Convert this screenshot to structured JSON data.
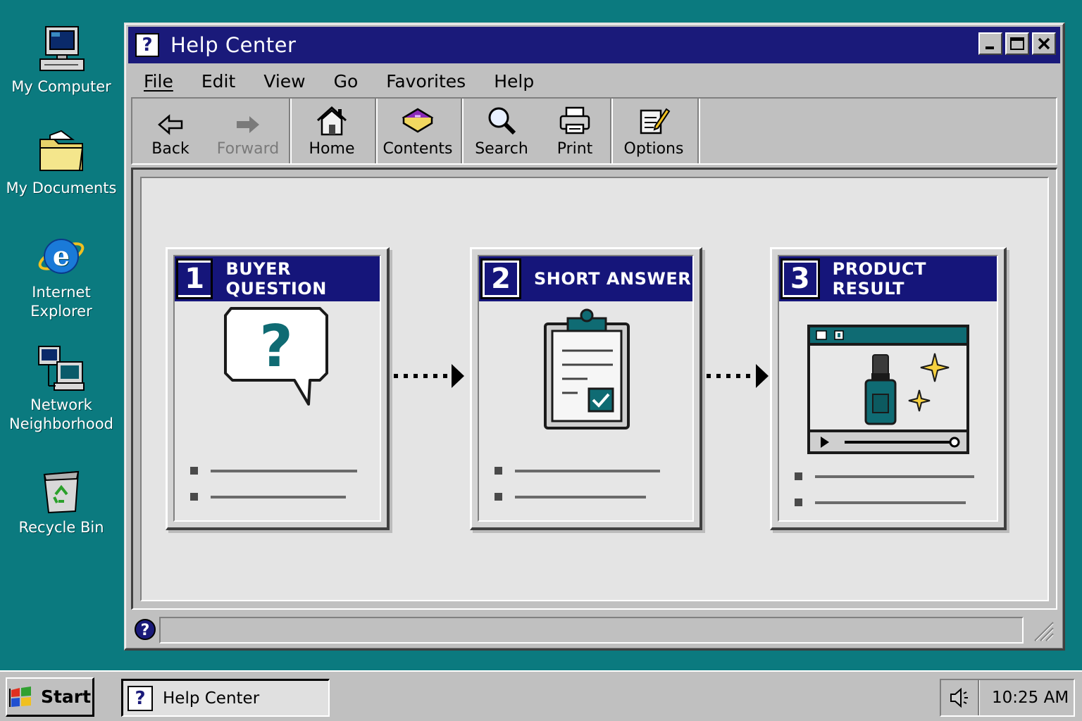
{
  "desktop": {
    "icons": [
      {
        "label": "My Computer"
      },
      {
        "label": "My Documents"
      },
      {
        "label": "Internet Explorer"
      },
      {
        "label": "Network Neighborhood"
      },
      {
        "label": "Recycle Bin"
      }
    ]
  },
  "window": {
    "title": "Help Center",
    "title_icon": "?",
    "menu": [
      "File",
      "Edit",
      "View",
      "Go",
      "Favorites",
      "Help"
    ],
    "toolbar": {
      "back": "Back",
      "forward": "Forward",
      "home": "Home",
      "contents": "Contents",
      "search": "Search",
      "print": "Print",
      "options": "Options"
    },
    "cards": [
      {
        "number": "1",
        "title": "BUYER QUESTION"
      },
      {
        "number": "2",
        "title": "SHORT ANSWER"
      },
      {
        "number": "3",
        "title": "PRODUCT RESULT"
      }
    ]
  },
  "taskbar": {
    "start_label": "Start",
    "task_label": "Help Center",
    "task_icon": "?",
    "clock": "10:25 AM"
  },
  "colors": {
    "desktop": "#0b7a7f",
    "titlebar": "#1a1a7a",
    "card_header": "#15157a",
    "accent_teal": "#0f6b73"
  }
}
